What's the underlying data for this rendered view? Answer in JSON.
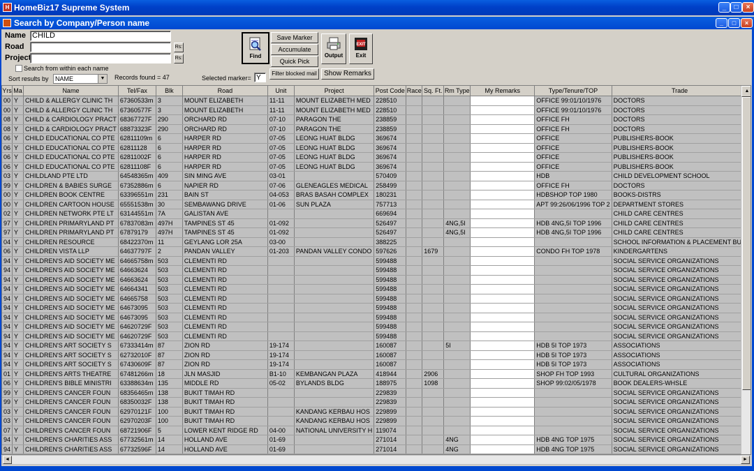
{
  "window": {
    "title": "HomeBiz17 Supreme System",
    "app_icon": "app-icon",
    "buttons": {
      "minimize": "_",
      "maximize": "□",
      "close": "×"
    }
  },
  "child_window": {
    "title": "Search by Company/Person name"
  },
  "search": {
    "name_label": "Name",
    "name_value": "CHILD",
    "road_label": "Road",
    "road_value": "",
    "project_label": "Project",
    "project_value": "",
    "reset_label": "Rs:",
    "search_within_label": "Search from within each name",
    "sort_label": "Sort results by",
    "sort_value": "NAME",
    "records_found": "Records found = 47",
    "selected_marker_label": "Selected marker=",
    "selected_marker_value": "Y"
  },
  "toolbar": {
    "find": "Find",
    "save_marker": "Save Marker",
    "accumulate": "Accumulate",
    "quick_pick": "Quick Pick",
    "filter_blocked_mail": "Filter blocked mail",
    "show_remarks": "Show Remarks",
    "output": "Output",
    "exit": "Exit"
  },
  "columns": [
    "Yrs",
    "Ma",
    "Name",
    "Tel/Fax",
    "Blk",
    "Road",
    "Unit",
    "Project",
    "Post Code",
    "Race",
    "Sq. Ft.",
    "Rm Type",
    "My Remarks",
    "Type/Tenure/TOP",
    "Trade"
  ],
  "rows": [
    [
      "00",
      "Y",
      "CHILD & ALLERGY CLINIC TH",
      "67360533m",
      "3",
      "MOUNT ELIZABETH",
      "11-11",
      "MOUNT ELIZABETH MED",
      "228510",
      "",
      "",
      "",
      "",
      "OFFICE 99:01/10/1976",
      "DOCTORS"
    ],
    [
      "00",
      "Y",
      "CHILD & ALLERGY CLINIC TH",
      "67360577F",
      "3",
      "MOUNT ELIZABETH",
      "11-11",
      "MOUNT ELIZABETH MED",
      "228510",
      "",
      "",
      "",
      "",
      "OFFICE 99:01/10/1976",
      "DOCTORS"
    ],
    [
      "08",
      "Y",
      "CHILD & CARDIOLOGY PRACT",
      "68367727F",
      "290",
      "ORCHARD RD",
      "07-10",
      "PARAGON THE",
      "238859",
      "",
      "",
      "",
      "",
      "OFFICE FH",
      "DOCTORS"
    ],
    [
      "08",
      "Y",
      "CHILD & CARDIOLOGY PRACT",
      "68873323F",
      "290",
      "ORCHARD RD",
      "07-10",
      "PARAGON THE",
      "238859",
      "",
      "",
      "",
      "",
      "OFFICE FH",
      "DOCTORS"
    ],
    [
      "06",
      "Y",
      "CHILD EDUCATIONAL CO PTE",
      "62811109m",
      "6",
      "HARPER RD",
      "07-05",
      "LEONG HUAT BLDG",
      "369674",
      "",
      "",
      "",
      "",
      "OFFICE",
      "PUBLISHERS-BOOK"
    ],
    [
      "06",
      "Y",
      "CHILD EDUCATIONAL CO PTE",
      "62811128",
      "6",
      "HARPER RD",
      "07-05",
      "LEONG HUAT BLDG",
      "369674",
      "",
      "",
      "",
      "",
      "OFFICE",
      "PUBLISHERS-BOOK"
    ],
    [
      "06",
      "Y",
      "CHILD EDUCATIONAL CO PTE",
      "62811002F",
      "6",
      "HARPER RD",
      "07-05",
      "LEONG HUAT BLDG",
      "369674",
      "",
      "",
      "",
      "",
      "OFFICE",
      "PUBLISHERS-BOOK"
    ],
    [
      "06",
      "Y",
      "CHILD EDUCATIONAL CO PTE",
      "62811108F",
      "6",
      "HARPER RD",
      "07-05",
      "LEONG HUAT BLDG",
      "369674",
      "",
      "",
      "",
      "",
      "OFFICE",
      "PUBLISHERS-BOOK"
    ],
    [
      "03",
      "Y",
      "CHILDLAND PTE LTD",
      "64548365m",
      "409",
      "SIN MING AVE",
      "03-01",
      "",
      "570409",
      "",
      "",
      "",
      "",
      "HDB",
      "CHILD DEVELOPMENT SCHOOL"
    ],
    [
      "99",
      "Y",
      "CHILDREN & BABIES SURGE",
      "67352886m",
      "6",
      "NAPIER RD",
      "07-06",
      "GLENEAGLES MEDICAL",
      "258499",
      "",
      "",
      "",
      "",
      "OFFICE FH",
      "DOCTORS"
    ],
    [
      "00",
      "Y",
      "CHILDREN BOOK CENTRE",
      "63396551m",
      "231",
      "BAIN ST",
      "04-053",
      "BRAS BASAH COMPLEX",
      "180231",
      "",
      "",
      "",
      "",
      "HDBSHOP TOP 1980",
      "BOOKS-DISTRS"
    ],
    [
      "00",
      "Y",
      "CHILDREN CARTOON HOUSE",
      "65551538m",
      "30",
      "SEMBAWANG DRIVE",
      "01-06",
      "SUN PLAZA",
      "757713",
      "",
      "",
      "",
      "",
      "APT 99:26/06/1996 TOP 2",
      "DEPARTMENT STORES"
    ],
    [
      "02",
      "Y",
      "CHILDREN NETWORK PTE LT",
      "63144551m",
      "7A",
      "GALISTAN AVE",
      "",
      "",
      "669694",
      "",
      "",
      "",
      "",
      "",
      "CHILD CARE CENTRES"
    ],
    [
      "97",
      "Y",
      "CHILDREN PRIMARYLAND PT",
      "67837083m",
      "497H",
      "TAMPINES ST 45",
      "01-092",
      "",
      "526497",
      "",
      "",
      "4NG,5I",
      "",
      "HDB 4NG,5I TOP 1996",
      "CHILD CARE CENTRES"
    ],
    [
      "97",
      "Y",
      "CHILDREN PRIMARYLAND PT",
      "67879179",
      "497H",
      "TAMPINES ST 45",
      "01-092",
      "",
      "526497",
      "",
      "",
      "4NG,5I",
      "",
      "HDB 4NG,5I TOP 1996",
      "CHILD CARE CENTRES"
    ],
    [
      "04",
      "Y",
      "CHILDREN RESOURCE",
      "68422370m",
      "11",
      "GEYLANG LOR 25A",
      "03-00",
      "",
      "388225",
      "",
      "",
      "",
      "",
      "",
      "SCHOOL INFORMATION & PLACEMENT BUR"
    ],
    [
      "06",
      "Y",
      "CHILDREN VISTA LLP",
      "64637797F",
      "2",
      "PANDAN VALLEY",
      "01-203",
      "PANDAN VALLEY CONDO",
      "597626",
      "",
      "1679",
      "",
      "",
      "CONDO FH TOP 1978",
      "KINDERGARTENS"
    ],
    [
      "94",
      "Y",
      "CHILDREN'S AID SOCIETY ME",
      "64665758m",
      "503",
      "CLEMENTI RD",
      "",
      "",
      "599488",
      "",
      "",
      "",
      "",
      "",
      "SOCIAL SERVICE ORGANIZATIONS"
    ],
    [
      "94",
      "Y",
      "CHILDREN'S AID SOCIETY ME",
      "64663624",
      "503",
      "CLEMENTI RD",
      "",
      "",
      "599488",
      "",
      "",
      "",
      "",
      "",
      "SOCIAL SERVICE ORGANIZATIONS"
    ],
    [
      "94",
      "Y",
      "CHILDREN'S AID SOCIETY ME",
      "64663624",
      "503",
      "CLEMENTI RD",
      "",
      "",
      "599488",
      "",
      "",
      "",
      "",
      "",
      "SOCIAL SERVICE ORGANIZATIONS"
    ],
    [
      "94",
      "Y",
      "CHILDREN'S AID SOCIETY ME",
      "64664341",
      "503",
      "CLEMENTI RD",
      "",
      "",
      "599488",
      "",
      "",
      "",
      "",
      "",
      "SOCIAL SERVICE ORGANIZATIONS"
    ],
    [
      "94",
      "Y",
      "CHILDREN'S AID SOCIETY ME",
      "64665758",
      "503",
      "CLEMENTI RD",
      "",
      "",
      "599488",
      "",
      "",
      "",
      "",
      "",
      "SOCIAL SERVICE ORGANIZATIONS"
    ],
    [
      "94",
      "Y",
      "CHILDREN'S AID SOCIETY ME",
      "64673095",
      "503",
      "CLEMENTI RD",
      "",
      "",
      "599488",
      "",
      "",
      "",
      "",
      "",
      "SOCIAL SERVICE ORGANIZATIONS"
    ],
    [
      "94",
      "Y",
      "CHILDREN'S AID SOCIETY ME",
      "64673095",
      "503",
      "CLEMENTI RD",
      "",
      "",
      "599488",
      "",
      "",
      "",
      "",
      "",
      "SOCIAL SERVICE ORGANIZATIONS"
    ],
    [
      "94",
      "Y",
      "CHILDREN'S AID SOCIETY ME",
      "64620729F",
      "503",
      "CLEMENTI RD",
      "",
      "",
      "599488",
      "",
      "",
      "",
      "",
      "",
      "SOCIAL SERVICE ORGANIZATIONS"
    ],
    [
      "94",
      "Y",
      "CHILDREN'S AID SOCIETY ME",
      "64620729F",
      "503",
      "CLEMENTI RD",
      "",
      "",
      "599488",
      "",
      "",
      "",
      "",
      "",
      "SOCIAL SERVICE ORGANIZATIONS"
    ],
    [
      "94",
      "Y",
      "CHILDREN'S ART SOCIETY S",
      "67333414m",
      "87",
      "ZION RD",
      "19-174",
      "",
      "160087",
      "",
      "",
      "5I",
      "",
      "HDB 5I TOP 1973",
      "ASSOCIATIONS"
    ],
    [
      "94",
      "Y",
      "CHILDREN'S ART SOCIETY S",
      "62732010F",
      "87",
      "ZION RD",
      "19-174",
      "",
      "160087",
      "",
      "",
      "",
      "",
      "HDB 5I TOP 1973",
      "ASSOCIATIONS"
    ],
    [
      "94",
      "Y",
      "CHILDREN'S ART SOCIETY S",
      "67430609F",
      "87",
      "ZION RD",
      "19-174",
      "",
      "160087",
      "",
      "",
      "",
      "",
      "HDB 5I TOP 1973",
      "ASSOCIATIONS"
    ],
    [
      "01",
      "Y",
      "CHILDREN'S ARTS THEATRE",
      "67481266m",
      "18",
      "JLN MASJID",
      "B1-10",
      "KEMBANGAN PLAZA",
      "418944",
      "",
      "2906",
      "",
      "",
      "SHOP FH TOP 1993",
      "CULTURAL ORGANIZATIONS"
    ],
    [
      "06",
      "Y",
      "CHILDREN'S BIBLE MINISTRI",
      "63388634m",
      "135",
      "MIDDLE RD",
      "05-02",
      "BYLANDS BLDG",
      "188975",
      "",
      "1098",
      "",
      "",
      "SHOP 99:02/05/1978",
      "BOOK DEALERS-WHSLE"
    ],
    [
      "99",
      "Y",
      "CHILDREN'S CANCER FOUN",
      "68356465m",
      "138",
      "BUKIT TIMAH RD",
      "",
      "",
      "229839",
      "",
      "",
      "",
      "",
      "",
      "SOCIAL SERVICE ORGANIZATIONS"
    ],
    [
      "99",
      "Y",
      "CHILDREN'S CANCER FOUN",
      "68350032F",
      "138",
      "BUKIT TIMAH RD",
      "",
      "",
      "229839",
      "",
      "",
      "",
      "",
      "",
      "SOCIAL SERVICE ORGANIZATIONS"
    ],
    [
      "03",
      "Y",
      "CHILDREN'S CANCER FOUN",
      "62970121F",
      "100",
      "BUKIT TIMAH RD",
      "",
      "KANDANG KERBAU HOS",
      "229899",
      "",
      "",
      "",
      "",
      "",
      "SOCIAL SERVICE ORGANIZATIONS"
    ],
    [
      "03",
      "Y",
      "CHILDREN'S CANCER FOUN",
      "62970203F",
      "100",
      "BUKIT TIMAH RD",
      "",
      "KANDANG KERBAU HOS",
      "229899",
      "",
      "",
      "",
      "",
      "",
      "SOCIAL SERVICE ORGANIZATIONS"
    ],
    [
      "07",
      "Y",
      "CHILDREN'S CANCER FOUN",
      "68721906F",
      "5",
      "LOWER KENT RIDGE RD",
      "04-00",
      "NATIONAL UNIVERSITY H",
      "119074",
      "",
      "",
      "",
      "",
      "",
      "SOCIAL SERVICE ORGANIZATIONS"
    ],
    [
      "94",
      "Y",
      "CHILDREN'S CHARITIES ASS",
      "67732561m",
      "14",
      "HOLLAND AVE",
      "01-69",
      "",
      "271014",
      "",
      "",
      "4NG",
      "",
      "HDB 4NG TOP 1975",
      "SOCIAL SERVICE ORGANIZATIONS"
    ],
    [
      "94",
      "Y",
      "CHILDREN'S CHARITIES ASS",
      "67732596F",
      "14",
      "HOLLAND AVE",
      "01-69",
      "",
      "271014",
      "",
      "",
      "4NG",
      "",
      "HDB 4NG TOP 1975",
      "SOCIAL SERVICE ORGANIZATIONS"
    ]
  ]
}
